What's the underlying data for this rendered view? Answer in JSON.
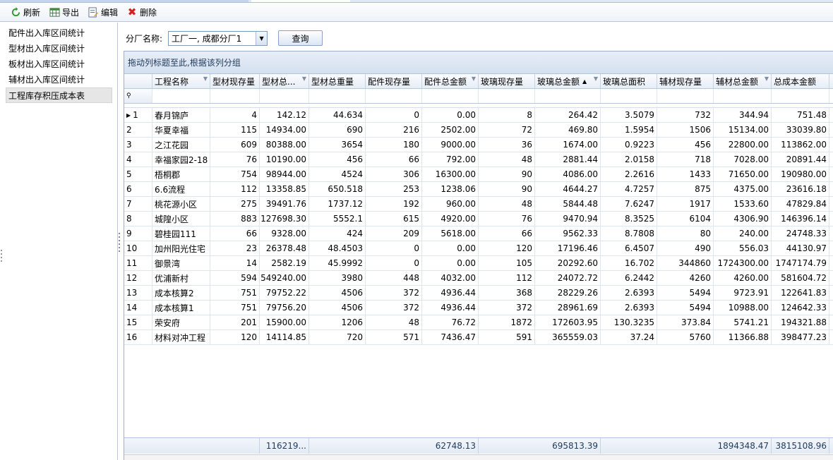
{
  "toolbar": {
    "refresh_label": "刷新",
    "export_label": "导出",
    "edit_label": "编辑",
    "delete_label": "删除"
  },
  "sidebar": {
    "items": [
      {
        "label": "配件出入库区间统计"
      },
      {
        "label": "型材出入库区间统计"
      },
      {
        "label": "板材出入库区间统计"
      },
      {
        "label": "辅材出入库区间统计"
      },
      {
        "label": "工程库存积压成本表"
      }
    ],
    "active_index": 4
  },
  "filter": {
    "label": "分厂名称:",
    "value": "工厂一, 成都分厂1",
    "query_label": "查询"
  },
  "grid": {
    "group_panel_text": "拖动列标题至此,根据该列分组",
    "columns": [
      "工程名称",
      "型材现存量",
      "型材总...",
      "型材总重量",
      "配件现存量",
      "配件总金额",
      "玻璃现存量",
      "玻璃总金额",
      "玻璃总面积",
      "辅材现存量",
      "辅材总金额",
      "总成本金额"
    ],
    "sorted_column_index": 7,
    "sort_direction": "ascending",
    "rows": [
      [
        "1",
        "春月锦庐",
        "4",
        "142.12",
        "44.634",
        "0",
        "0.00",
        "8",
        "264.42",
        "3.5079",
        "732",
        "344.94",
        "751.48"
      ],
      [
        "2",
        "华夏幸福",
        "115",
        "14934.00",
        "690",
        "216",
        "2502.00",
        "72",
        "469.80",
        "1.5954",
        "1506",
        "15134.00",
        "33039.80"
      ],
      [
        "3",
        "之江花园",
        "609",
        "80388.00",
        "3654",
        "180",
        "9000.00",
        "36",
        "1674.00",
        "0.9223",
        "456",
        "22800.00",
        "113862.00"
      ],
      [
        "4",
        "幸福家园2-18",
        "76",
        "10190.00",
        "456",
        "66",
        "792.00",
        "48",
        "2881.44",
        "2.0158",
        "718",
        "7028.00",
        "20891.44"
      ],
      [
        "5",
        "梧桐郡",
        "754",
        "98944.00",
        "4524",
        "306",
        "16300.00",
        "90",
        "4086.00",
        "2.2616",
        "1433",
        "71650.00",
        "190980.00"
      ],
      [
        "6",
        "6.6流程",
        "112",
        "13358.85",
        "650.518",
        "253",
        "1238.06",
        "90",
        "4644.27",
        "4.7257",
        "875",
        "4375.00",
        "23616.18"
      ],
      [
        "7",
        "桃花源小区",
        "275",
        "39491.76",
        "1737.12",
        "192",
        "960.00",
        "48",
        "5844.48",
        "7.6247",
        "1917",
        "1533.60",
        "47829.84"
      ],
      [
        "8",
        "城隍小区",
        "883",
        "127698.30",
        "5552.1",
        "615",
        "4920.00",
        "76",
        "9470.94",
        "8.3525",
        "6104",
        "4306.90",
        "146396.14"
      ],
      [
        "9",
        "碧桂园111",
        "66",
        "9328.00",
        "424",
        "209",
        "5618.00",
        "66",
        "9562.33",
        "8.7808",
        "80",
        "240.00",
        "24748.33"
      ],
      [
        "10",
        "加州阳光住宅",
        "23",
        "26378.48",
        "48.4503",
        "0",
        "0.00",
        "120",
        "17196.46",
        "6.4507",
        "490",
        "556.03",
        "44130.97"
      ],
      [
        "11",
        "御景湾",
        "14",
        "2582.19",
        "45.9992",
        "0",
        "0.00",
        "105",
        "20292.60",
        "16.702",
        "344860",
        "1724300.00",
        "1747174.79"
      ],
      [
        "12",
        "优浦新村",
        "594",
        "549240.00",
        "3980",
        "448",
        "4032.00",
        "112",
        "24072.72",
        "6.2442",
        "4260",
        "4260.00",
        "581604.72"
      ],
      [
        "13",
        "成本核算2",
        "751",
        "79752.22",
        "4506",
        "372",
        "4936.44",
        "368",
        "28229.26",
        "2.6393",
        "5494",
        "9723.91",
        "122641.83"
      ],
      [
        "14",
        "成本核算1",
        "751",
        "79756.20",
        "4506",
        "372",
        "4936.44",
        "372",
        "28961.69",
        "2.6393",
        "5494",
        "10988.00",
        "124642.33"
      ],
      [
        "15",
        "荣安府",
        "201",
        "15900.00",
        "1206",
        "48",
        "76.72",
        "1872",
        "172603.95",
        "130.3235",
        "373.84",
        "5741.21",
        "194321.88"
      ],
      [
        "16",
        "材料对冲工程",
        "120",
        "14114.85",
        "720",
        "571",
        "7436.47",
        "591",
        "365559.03",
        "37.24",
        "5760",
        "11366.88",
        "398477.23"
      ]
    ],
    "footer": {
      "profile_total": "116219...",
      "parts_total": "62748.13",
      "glass_total": "695813.39",
      "aux_total": "1894348.47",
      "cost_total": "3815108.96"
    }
  }
}
